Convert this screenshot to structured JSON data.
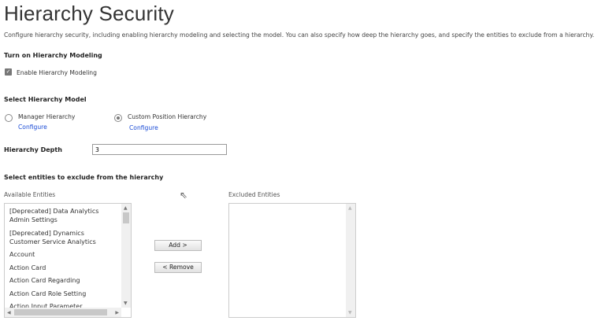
{
  "title": "Hierarchy Security",
  "description": "Configure hierarchy security, including enabling hierarchy modeling and selecting the model. You can also specify how deep the hierarchy goes, and specify the entities to exclude from a hierarchy.",
  "modeling": {
    "heading": "Turn on Hierarchy Modeling",
    "checkbox_label": "Enable Hierarchy Modeling",
    "checked": true
  },
  "model": {
    "heading": "Select Hierarchy Model",
    "options": [
      {
        "label": "Manager Hierarchy",
        "link": "Configure",
        "selected": false
      },
      {
        "label": "Custom Position Hierarchy",
        "link": "Configure",
        "selected": true
      }
    ]
  },
  "depth": {
    "label": "Hierarchy Depth",
    "value": "3"
  },
  "exclude": {
    "heading": "Select entities to exclude from the hierarchy",
    "available_label": "Available Entities",
    "excluded_label": "Excluded Entities",
    "available": [
      "[Deprecated] Data Analytics Admin Settings",
      "[Deprecated] Dynamics Customer Service Analytics",
      "Account",
      "Action Card",
      "Action Card Regarding",
      "Action Card Role Setting",
      "Action Input Parameter"
    ],
    "excluded": [],
    "add_label": "Add >",
    "remove_label": "< Remove"
  }
}
